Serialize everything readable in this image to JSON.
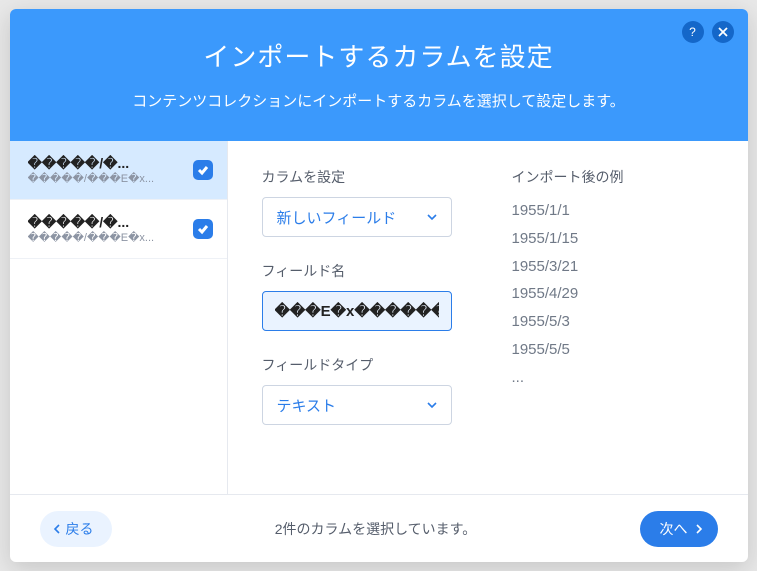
{
  "header": {
    "title": "インポートするカラムを設定",
    "subtitle": "コンテンツコレクションにインポートするカラムを選択して設定します。"
  },
  "sidebar": {
    "items": [
      {
        "title": "�����\u0007/�...",
        "sub": "�����\u0007/���E�x...",
        "checked": true,
        "selected": true
      },
      {
        "title": "�����\u0007/�...",
        "sub": "�����\u0007/���E�x...",
        "checked": true,
        "selected": false
      }
    ]
  },
  "form": {
    "column_label": "カラムを設定",
    "column_value": "新しいフィールド",
    "fieldname_label": "フィールド名",
    "fieldname_value": "���E�x������",
    "fieldtype_label": "フィールドタイプ",
    "fieldtype_value": "テキスト"
  },
  "preview": {
    "label": "インポート後の例",
    "items": [
      "1955/1/1",
      "1955/1/15",
      "1955/3/21",
      "1955/4/29",
      "1955/5/3",
      "1955/5/5",
      "..."
    ]
  },
  "footer": {
    "back": "戻る",
    "status": "2件のカラムを選択しています。",
    "next": "次へ"
  }
}
